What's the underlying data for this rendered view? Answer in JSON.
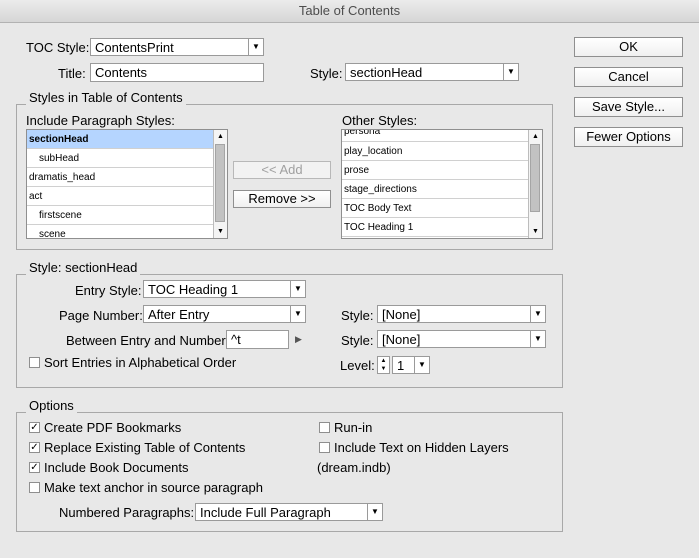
{
  "window": {
    "title": "Table of Contents"
  },
  "top": {
    "toc_style_label": "TOC Style:",
    "toc_style_value": "ContentsPrint",
    "title_label": "Title:",
    "title_value": "Contents",
    "style_label": "Style:",
    "style_value": "sectionHead"
  },
  "buttons": {
    "ok": "OK",
    "cancel": "Cancel",
    "save_style": "Save Style...",
    "fewer_options": "Fewer Options",
    "add": "<< Add",
    "remove": "Remove >>"
  },
  "styles_group": {
    "title": "Styles in Table of Contents",
    "include_label": "Include Paragraph Styles:",
    "include_items": [
      {
        "label": "sectionHead",
        "selected": true,
        "indent": false
      },
      {
        "label": "subHead",
        "selected": false,
        "indent": true
      },
      {
        "label": "dramatis_head",
        "selected": false,
        "indent": false
      },
      {
        "label": "act",
        "selected": false,
        "indent": false
      },
      {
        "label": "firstscene",
        "selected": false,
        "indent": true
      },
      {
        "label": "scene",
        "selected": false,
        "indent": true
      }
    ],
    "other_label": "Other Styles:",
    "other_items": [
      "persona",
      "play_location",
      "prose",
      "stage_directions",
      "TOC Body Text",
      "TOC Heading 1"
    ]
  },
  "style_group": {
    "title": "Style: sectionHead",
    "entry_style_label": "Entry Style:",
    "entry_style_value": "TOC Heading 1",
    "page_number_label": "Page Number:",
    "page_number_value": "After Entry",
    "between_label": "Between Entry and Number:",
    "between_value": "^t",
    "style_label_1": "Style:",
    "style_value_1": "[None]",
    "style_label_2": "Style:",
    "style_value_2": "[None]",
    "sort_label": "Sort Entries in Alphabetical Order",
    "sort_checked": false,
    "level_label": "Level:",
    "level_value": "1"
  },
  "options_group": {
    "title": "Options",
    "create_pdf": {
      "label": "Create PDF Bookmarks",
      "checked": true
    },
    "replace_existing": {
      "label": "Replace Existing Table of Contents",
      "checked": true
    },
    "include_book": {
      "label": "Include Book Documents",
      "checked": true
    },
    "make_anchor": {
      "label": "Make text anchor in source paragraph",
      "checked": false
    },
    "run_in": {
      "label": "Run-in",
      "checked": false
    },
    "hidden_layers": {
      "label": "Include Text on Hidden Layers",
      "checked": false
    },
    "book_name": "(dream.indb)",
    "numbered_label": "Numbered Paragraphs:",
    "numbered_value": "Include Full Paragraph"
  },
  "icons": {
    "check": "✓",
    "arrow_down": "▼",
    "arrow_up": "▲",
    "arrow_right": "▶"
  }
}
